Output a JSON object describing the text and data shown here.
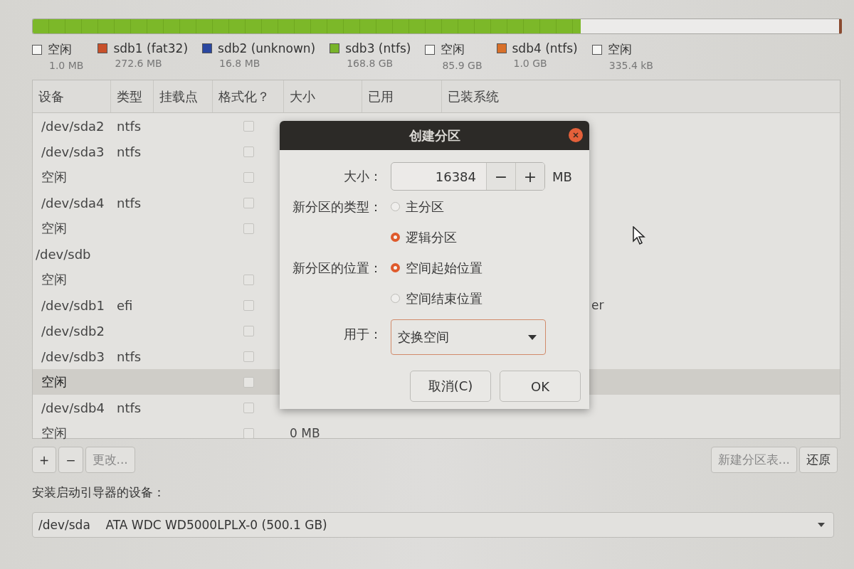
{
  "usage_bar": {
    "level": 0.68
  },
  "legend": [
    {
      "label": "空闲",
      "size": "1.0 MB",
      "color": "#f6f6f4"
    },
    {
      "label": "sdb1 (fat32)",
      "size": "272.6 MB",
      "color": "#c8502a"
    },
    {
      "label": "sdb2 (unknown)",
      "size": "16.8 MB",
      "color": "#2a47a0"
    },
    {
      "label": "sdb3 (ntfs)",
      "size": "168.8 GB",
      "color": "#78b42a"
    },
    {
      "label": "空闲",
      "size": "85.9 GB",
      "color": "#f6f6f4"
    },
    {
      "label": "sdb4 (ntfs)",
      "size": "1.0 GB",
      "color": "#d8702a"
    },
    {
      "label": "空闲",
      "size": "335.4 kB",
      "color": "#f6f6f4"
    }
  ],
  "table": {
    "columns": [
      "设备",
      "类型",
      "挂载点",
      "格式化？",
      "大小",
      "已用",
      "已装系统"
    ],
    "rows": [
      {
        "kind": "partition",
        "device": "/dev/sda2",
        "type": "ntfs",
        "format": false,
        "selected": false
      },
      {
        "kind": "partition",
        "device": "/dev/sda3",
        "type": "ntfs",
        "format": false,
        "selected": false
      },
      {
        "kind": "partition",
        "device": "空闲",
        "format": false,
        "selected": false
      },
      {
        "kind": "partition",
        "device": "/dev/sda4",
        "type": "ntfs",
        "format": false,
        "selected": false
      },
      {
        "kind": "partition",
        "device": "空闲",
        "format": false,
        "selected": false
      },
      {
        "kind": "disk",
        "device": "/dev/sdb",
        "selected": false
      },
      {
        "kind": "partition",
        "device": "空闲",
        "format": false,
        "selected": false
      },
      {
        "kind": "partition",
        "device": "/dev/sdb1",
        "type": "efi",
        "format": false,
        "system": "er",
        "selected": false
      },
      {
        "kind": "partition",
        "device": "/dev/sdb2",
        "format": false,
        "selected": false
      },
      {
        "kind": "partition",
        "device": "/dev/sdb3",
        "type": "ntfs",
        "format": false,
        "selected": false
      },
      {
        "kind": "partition",
        "device": "空闲",
        "format": false,
        "selected": true
      },
      {
        "kind": "partition",
        "device": "/dev/sdb4",
        "type": "ntfs",
        "format": false,
        "selected": false
      },
      {
        "kind": "partition",
        "device": "空闲",
        "format": false,
        "size": "0 MB",
        "selected": false
      }
    ]
  },
  "toolbar": [
    {
      "label": "+",
      "disabled": false
    },
    {
      "label": "−",
      "disabled": false
    },
    {
      "label": "更改...",
      "disabled": true
    }
  ],
  "toolbar_right": [
    {
      "label": "新建分区表...",
      "disabled": true
    },
    {
      "label": "还原",
      "disabled": false
    }
  ],
  "bootloader": {
    "label": "安装启动引导器的设备：",
    "value": "/dev/sda    ATA WDC WD5000LPLX-0 (500.1 GB)"
  },
  "dialog": {
    "title": "创建分区",
    "size_label": "大小：",
    "size_value": "16384",
    "minus": "−",
    "plus": "+",
    "unit": "MB",
    "type_label": "新分区的类型：",
    "types": [
      {
        "label": "主分区",
        "selected": false
      },
      {
        "label": "逻辑分区",
        "selected": true
      }
    ],
    "location_label": "新分区的位置：",
    "locations": [
      {
        "label": "空间起始位置",
        "selected": true
      },
      {
        "label": "空间结束位置",
        "selected": false
      }
    ],
    "use_label": "用于：",
    "use_value": "交换空间",
    "buttons": [
      "取消(C)",
      "OK"
    ]
  }
}
